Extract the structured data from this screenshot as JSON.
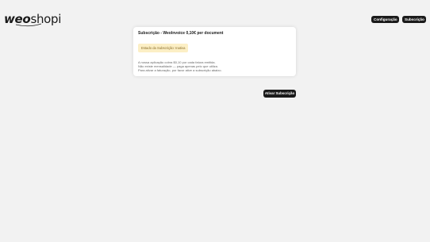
{
  "header": {
    "logo": {
      "part1": "weo",
      "part2": "shopi"
    },
    "config_label": "Configuração",
    "subscription_label": "Subscrição"
  },
  "card": {
    "title": "Subscrição - WeoInvoice 0,10€ per document",
    "status": "Estado da Subscrição: Inativa",
    "info_lines": [
      "A nossa aplicação cobra $0,10 por cada fatura emitida.",
      "Não existe mensalidade — paga apenas pelo que utiliza.",
      "Para ativar a faturação, por favor ative a subscrição abaixo."
    ]
  },
  "activate_label": "Ativar Subscrição",
  "colors": {
    "background": "#f2f2f2",
    "button": "#1a1a1a",
    "status_bg": "#fcefc5",
    "status_text": "#8a6d2a"
  }
}
